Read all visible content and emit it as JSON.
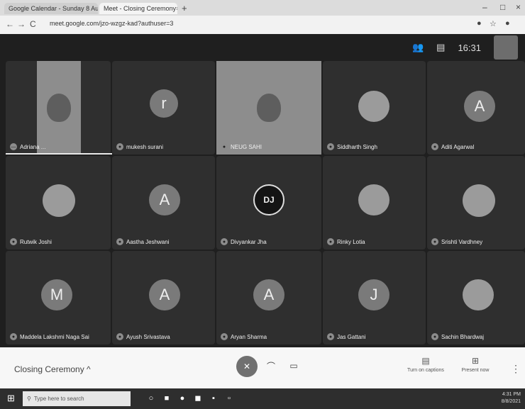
{
  "browser": {
    "tabs": [
      {
        "title": "Google Calendar - Sunday 8 Au...",
        "close": "×"
      },
      {
        "title": "Meet - Closing Ceremony",
        "close": "× ×"
      }
    ],
    "new_tab": "+",
    "window_controls": {
      "minimize": "–",
      "maximize": "□",
      "close": "×"
    },
    "back": "←",
    "forward": "→",
    "reload": "C",
    "url": "meet.google.com/jzo-wzgz-kad?authuser=3"
  },
  "meet": {
    "top": {
      "people_icon": "👥",
      "chat_icon": "▤",
      "time": "16:31"
    },
    "tiles": [
      {
        "name": "Adriana ...",
        "type": "video"
      },
      {
        "name": "mukesh surani",
        "avatar": "r",
        "type": "letter"
      },
      {
        "name": "NEUG SAHI",
        "type": "video"
      },
      {
        "name": "Siddharth Singh",
        "avatar": "",
        "type": "photo"
      },
      {
        "name": "Aditi Agarwal",
        "avatar": "A",
        "type": "letter"
      },
      {
        "name": "Rutwik Joshi",
        "avatar": "",
        "type": "photo"
      },
      {
        "name": "Aastha Jeshwani",
        "avatar": "A",
        "type": "letter"
      },
      {
        "name": "Divyankar Jha",
        "avatar": "DJ",
        "type": "logo"
      },
      {
        "name": "Rinky Lotia",
        "avatar": "",
        "type": "photo"
      },
      {
        "name": "Srishti Vardhney",
        "avatar": "",
        "type": "photo"
      },
      {
        "name": "Maddela Lakshmi Naga Sai",
        "avatar": "M",
        "type": "letter"
      },
      {
        "name": "Ayush Srivastava",
        "avatar": "A",
        "type": "letter"
      },
      {
        "name": "Aryan Sharma",
        "avatar": "A",
        "type": "letter"
      },
      {
        "name": "Jas Gattani",
        "avatar": "J",
        "type": "letter"
      },
      {
        "name": "Sachin Bhardwaj",
        "avatar": "",
        "type": "photo"
      }
    ]
  },
  "controls": {
    "meeting_title": "Closing Ceremony ^",
    "end_call": "✆",
    "end_call_glyph": "✕",
    "captions_label": "Turn on captions",
    "present_label": "Present now",
    "more": "⋮"
  },
  "taskbar": {
    "search_placeholder": "Type here to search",
    "time": "4:31 PM",
    "date": "8/8/2021"
  }
}
